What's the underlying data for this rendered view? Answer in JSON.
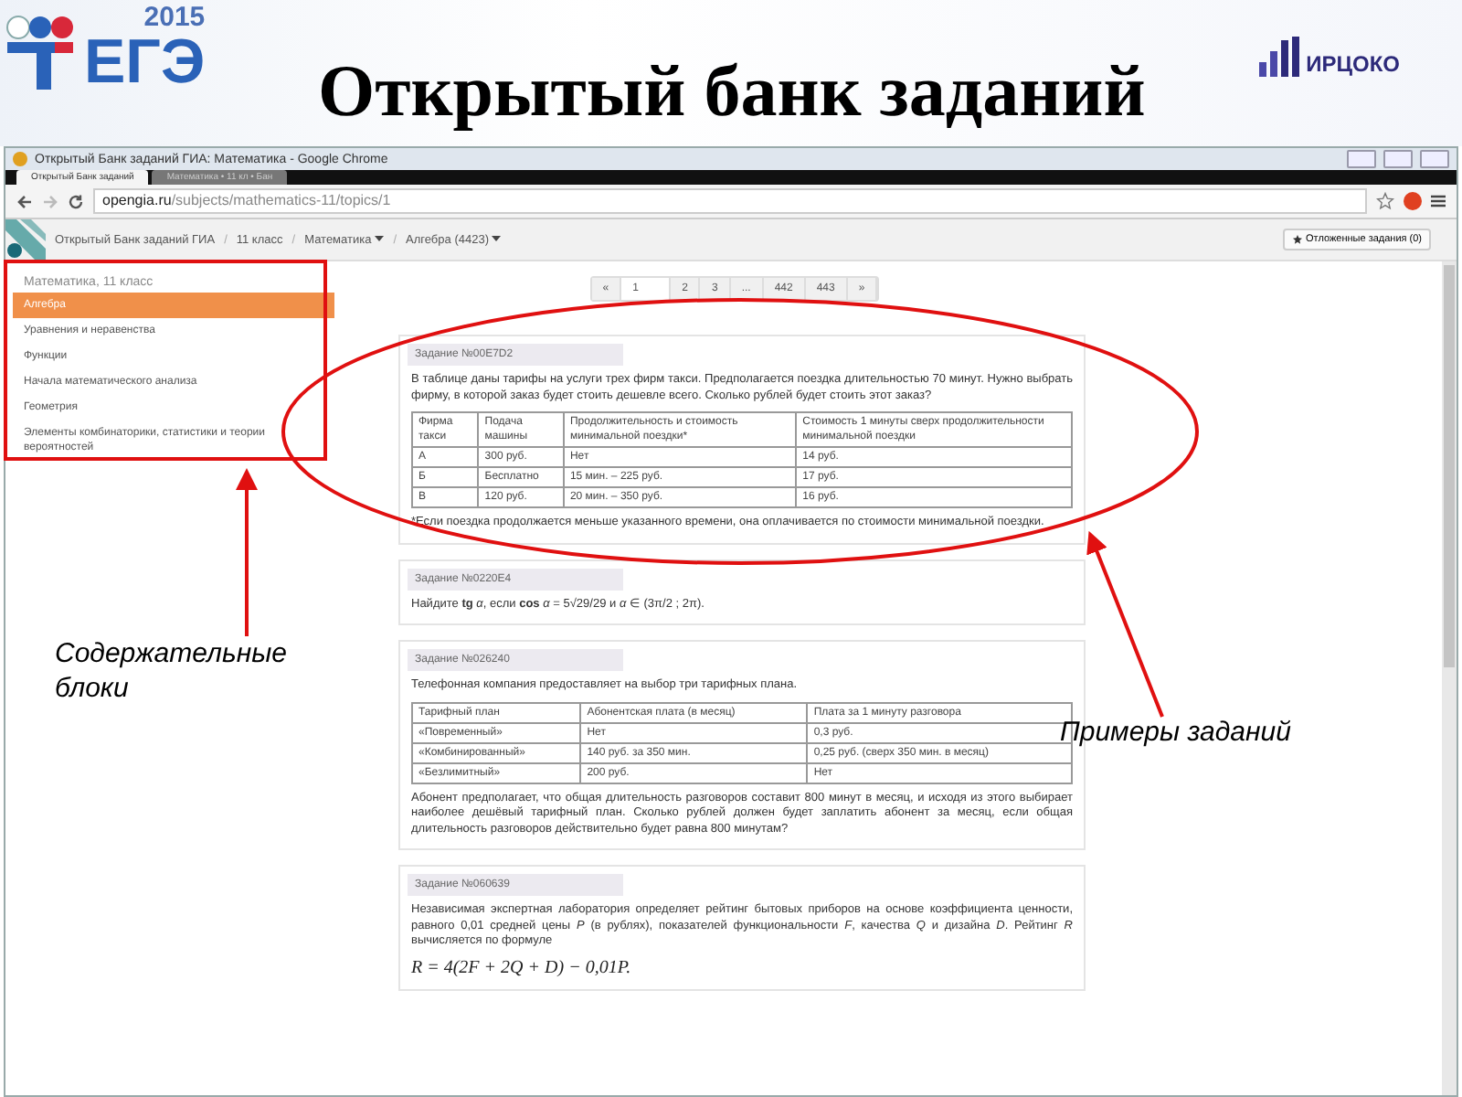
{
  "slide": {
    "title": "Открытый банк заданий",
    "logo_year": "2015",
    "logo_text": "ЕГЭ",
    "partner_logo_text": "ИРЦОКО"
  },
  "browser": {
    "window_title": "Открытый Банк заданий ГИА: Математика - Google Chrome",
    "tabs": [
      {
        "label": "Открытый Банк заданий",
        "selected": true
      },
      {
        "label": "Математика • 11 кл • Бан",
        "selected": false
      }
    ],
    "url_host": "opengia.ru",
    "url_path": "/subjects/mathematics-11/topics/1"
  },
  "navbar": {
    "breadcrumbs": [
      {
        "kind": "link",
        "label": "Открытый Банк заданий ГИА",
        "dropdown": false
      },
      {
        "kind": "separator",
        "label": "/"
      },
      {
        "kind": "link",
        "label": "11 класс",
        "dropdown": false
      },
      {
        "kind": "separator",
        "label": "/"
      },
      {
        "kind": "link",
        "label": "Математика",
        "dropdown": true
      },
      {
        "kind": "separator",
        "label": "/"
      },
      {
        "kind": "link",
        "label": "Алгебра (4423)",
        "dropdown": true
      }
    ],
    "postponed_button": "Отложенные задания (0)"
  },
  "sidebar": {
    "heading": "Математика, 11 класс",
    "items": [
      {
        "label": "Алгебра",
        "selected": true
      },
      {
        "label": "Уравнения и неравенства",
        "selected": false
      },
      {
        "label": "Функции",
        "selected": false
      },
      {
        "label": "Начала математического анализа",
        "selected": false
      },
      {
        "label": "Геометрия",
        "selected": false
      },
      {
        "label": "Элементы комбинаторики, статистики и теории вероятностей",
        "selected": false
      }
    ]
  },
  "pagination": [
    {
      "label": "«",
      "selected": false
    },
    {
      "label": "1",
      "selected": true
    },
    {
      "label": "2",
      "selected": false
    },
    {
      "label": "3",
      "selected": false
    },
    {
      "label": "...",
      "selected": false
    },
    {
      "label": "442",
      "selected": false
    },
    {
      "label": "443",
      "selected": false
    },
    {
      "label": "»",
      "selected": false
    }
  ],
  "tasks": [
    {
      "title": "Задание №00E7D2",
      "blocks": [
        {
          "kind": "text",
          "text": "В таблице даны тарифы на услуги трех фирм такси. Предполагается поездка длительностью 70 минут. Нужно выбрать фирму, в которой заказ будет стоить дешевле всего. Сколько рублей будет стоить этот заказ?"
        },
        {
          "kind": "table",
          "rows": [
            [
              "Фирма такси",
              "Подача машины",
              "Продолжительность и стоимость минимальной поездки*",
              "Стоимость 1 минуты сверх продолжительности минимальной поездки"
            ],
            [
              "А",
              "300 руб.",
              "Нет",
              "14 руб."
            ],
            [
              "Б",
              "Бесплатно",
              "15 мин. – 225 руб.",
              "17 руб."
            ],
            [
              "В",
              "120 руб.",
              "20 мин. – 350 руб.",
              "16 руб."
            ]
          ]
        },
        {
          "kind": "text",
          "text": "*Если поездка продолжается меньше указанного времени, она оплачивается по стоимости минимальной поездки."
        }
      ]
    },
    {
      "title": "Задание №0220E4",
      "blocks": [
        {
          "kind": "text",
          "text": "Найдите **tg** *α*, если **cos** *α* = 5√29/29 и *α* ∈ (3π/2 ; 2π)."
        }
      ]
    },
    {
      "title": "Задание №026240",
      "blocks": [
        {
          "kind": "text",
          "text": "Телефонная компания предоставляет на выбор три тарифных плана."
        },
        {
          "kind": "table",
          "rows": [
            [
              "Тарифный план",
              "Абонентская плата (в месяц)",
              "Плата за 1 минуту разговора"
            ],
            [
              "«Повременный»",
              "Нет",
              "0,3 руб."
            ],
            [
              "«Комбинированный»",
              "140 руб. за 350 мин.",
              "0,25 руб. (сверх 350 мин. в месяц)"
            ],
            [
              "«Безлимитный»",
              "200 руб.",
              "Нет"
            ]
          ]
        },
        {
          "kind": "text",
          "text": "Абонент предполагает, что общая длительность разговоров составит 800 минут в месяц, и исходя из этого выбирает наиболее дешёвый тарифный план. Сколько рублей должен будет заплатить абонент за месяц, если общая длительность разговоров действительно будет равна 800 минутам?"
        }
      ]
    },
    {
      "title": "Задание №060639",
      "blocks": [
        {
          "kind": "text",
          "text": "Независимая экспертная лаборатория определяет рейтинг бытовых приборов на основе коэффициента ценности, равного 0,01 средней цены *P* (в рублях), показателей функциональности *F*, качества *Q* и дизайна *D*. Рейтинг *R* вычисляется по формуле"
        },
        {
          "kind": "formula",
          "text": "R = 4(2F + 2Q + D) − 0,01P."
        }
      ]
    }
  ],
  "annotations": {
    "sidebar_label": "Содержательные блоки",
    "tasks_label": "Примеры заданий"
  }
}
